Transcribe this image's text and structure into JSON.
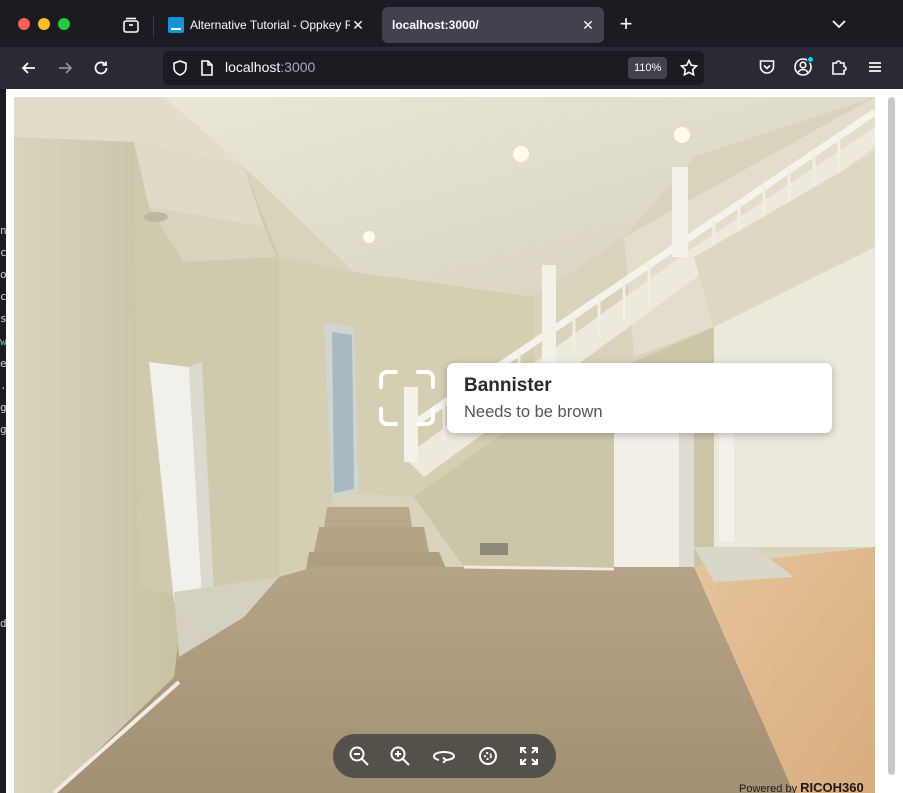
{
  "browser": {
    "tabs": [
      {
        "title": "Alternative Tutorial - Oppkey RIC",
        "active": false
      },
      {
        "title": "localhost:3000/",
        "active": true
      }
    ],
    "url_host": "localhost",
    "url_port": ":3000",
    "zoom": "110%"
  },
  "viewer": {
    "hotspot": {
      "title": "Bannister",
      "description": "Needs to be brown"
    },
    "powered_by_prefix": "Powered by",
    "powered_by_brand": "RICOH360"
  },
  "edge_fragments": [
    "n",
    "c",
    "o",
    "c",
    "s",
    "w",
    "e",
    ".",
    "g",
    "g",
    "d"
  ],
  "colors": {
    "chrome_dark": "#1c1b22",
    "toolbar": "#2b2a33",
    "active_tab": "#42414d",
    "favicon": "#1593d6",
    "close_red": "#ff5f57",
    "minimize_yellow": "#febc2e",
    "zoom_green": "#28c840"
  },
  "icons": {
    "tab_overview": "tab-overview-icon",
    "new_tab": "plus-icon",
    "list_tabs": "chevron-down-icon",
    "back": "arrow-left-icon",
    "forward": "arrow-right-icon",
    "reload": "reload-icon",
    "tracking": "shield-icon",
    "page": "page-icon",
    "bookmark": "star-icon",
    "pocket": "pocket-icon",
    "account": "account-icon",
    "extensions": "puzzle-icon",
    "menu": "hamburger-icon",
    "zoom_out": "zoom-out-icon",
    "zoom_in": "zoom-in-icon",
    "move": "rotate-icon",
    "autorotate": "autorotate-icon",
    "fullscreen": "fullscreen-icon"
  }
}
